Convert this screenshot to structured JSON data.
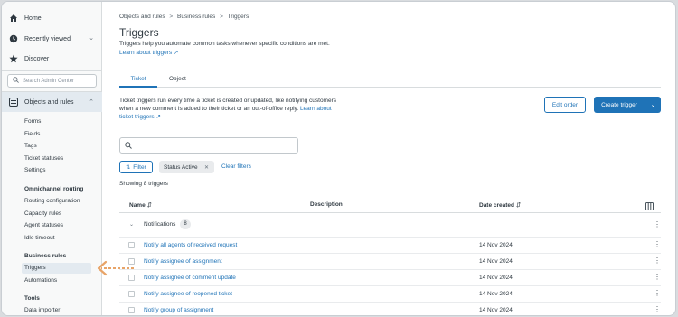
{
  "sidebar": {
    "home": "Home",
    "recently_viewed": "Recently viewed",
    "discover": "Discover",
    "search_placeholder": "Search Admin Center",
    "objects_and_rules": "Objects and rules",
    "items": [
      "Forms",
      "Fields",
      "Tags",
      "Ticket statuses",
      "Settings"
    ],
    "omnichannel_heading": "Omnichannel routing",
    "omnichannel_items": [
      "Routing configuration",
      "Capacity rules",
      "Agent statuses",
      "Idle timeout"
    ],
    "business_rules_heading": "Business rules",
    "business_rules_items": [
      "Triggers",
      "Automations"
    ],
    "tools_heading": "Tools",
    "tools_items": [
      "Data importer"
    ]
  },
  "breadcrumb": [
    "Objects and rules",
    "Business rules",
    "Triggers"
  ],
  "page": {
    "title": "Triggers",
    "description": "Triggers help you automate common tasks whenever specific conditions are met.",
    "learn_link": "Learn about triggers"
  },
  "tabs": [
    "Ticket",
    "Object"
  ],
  "info": {
    "text": "Ticket triggers run every time a ticket is created or updated, like notifying customers when a new comment is added to their ticket or an out-of-office reply.",
    "link": "Learn about ticket triggers"
  },
  "buttons": {
    "edit_order": "Edit order",
    "create_trigger": "Create trigger"
  },
  "filters": {
    "filter_label": "Filter",
    "status_pill": "Status Active",
    "clear": "Clear filters"
  },
  "showing": "Showing 8 triggers",
  "table": {
    "headers": {
      "name": "Name",
      "description": "Description",
      "date": "Date created"
    },
    "group": {
      "label": "Notifications",
      "count": "8"
    },
    "rows": [
      {
        "name": "Notify all agents of received request",
        "date": "14 Nov 2024"
      },
      {
        "name": "Notify assignee of assignment",
        "date": "14 Nov 2024"
      },
      {
        "name": "Notify assignee of comment update",
        "date": "14 Nov 2024"
      },
      {
        "name": "Notify assignee of reopened ticket",
        "date": "14 Nov 2024"
      },
      {
        "name": "Notify group of assignment",
        "date": "14 Nov 2024"
      }
    ]
  },
  "colors": {
    "accent": "#1f73b7",
    "highlight_arrow": "#e8a468"
  }
}
